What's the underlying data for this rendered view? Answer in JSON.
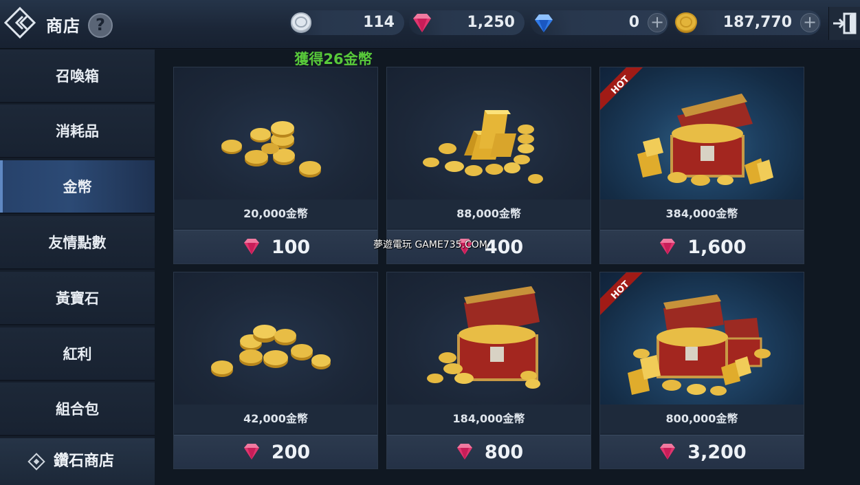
{
  "header": {
    "title": "商店",
    "help_label": "?",
    "currencies": [
      {
        "icon": "silver-coin-icon",
        "value": "114",
        "plus": false
      },
      {
        "icon": "ruby-icon",
        "value": "1,250",
        "plus": false
      },
      {
        "icon": "sapphire-icon",
        "value": "0",
        "plus": true
      },
      {
        "icon": "gold-coin-icon",
        "value": "187,770",
        "plus": true
      }
    ],
    "plus_label": "+"
  },
  "sidebar": {
    "items": [
      {
        "label": "召喚箱",
        "active": false
      },
      {
        "label": "消耗品",
        "active": false
      },
      {
        "label": "金幣",
        "active": true
      },
      {
        "label": "友情點數",
        "active": false
      },
      {
        "label": "黃寶石",
        "active": false
      },
      {
        "label": "紅利",
        "active": false
      },
      {
        "label": "組合包",
        "active": false
      }
    ],
    "store_label": "鑽石商店"
  },
  "notice": "獲得26金幣",
  "products": [
    {
      "amount": "20,000金幣",
      "price": "100",
      "hot": false,
      "art": "coins-small"
    },
    {
      "amount": "88,000金幣",
      "price": "400",
      "hot": false,
      "art": "gold-bars"
    },
    {
      "amount": "384,000金幣",
      "price": "1,600",
      "hot": true,
      "art": "chest"
    },
    {
      "amount": "42,000金幣",
      "price": "200",
      "hot": false,
      "art": "coins-medium"
    },
    {
      "amount": "184,000金幣",
      "price": "800",
      "hot": false,
      "art": "chest"
    },
    {
      "amount": "800,000金幣",
      "price": "3,200",
      "hot": true,
      "art": "chest-large"
    }
  ],
  "hot_label": "HOT",
  "watermark": "夢遊電玩 GAME735.COM",
  "colors": {
    "notice_green": "#58c93a",
    "active_tab": "#2c4a75",
    "ruby": "#e0356e",
    "gold": "#e3b43a"
  }
}
